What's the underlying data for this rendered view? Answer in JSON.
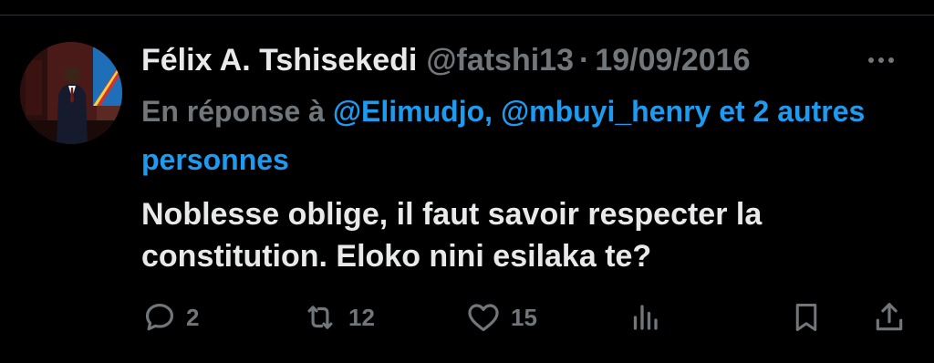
{
  "tweet": {
    "author_name": "Félix A. Tshisekedi",
    "handle": "@fatshi13",
    "separator": "·",
    "date": "19/09/2016",
    "reply_prefix": "En réponse à",
    "reply_mentions": "@Elimudjo, @mbuyi_henry et 2 autres personnes",
    "text": "Noblesse oblige, il faut savoir respecter la constitution. Eloko nini esilaka te?",
    "icons": {
      "more": "more-horizontal-icon",
      "reply": "reply-icon",
      "retweet": "retweet-icon",
      "like": "heart-icon",
      "views": "views-icon",
      "bookmark": "bookmark-icon",
      "share": "share-icon"
    }
  },
  "actions": {
    "replies": "2",
    "retweets": "12",
    "likes": "15"
  },
  "colors": {
    "background": "#000000",
    "primary_text": "#e7e9ea",
    "secondary_text": "#71767b",
    "accent": "#1d9bf0"
  }
}
